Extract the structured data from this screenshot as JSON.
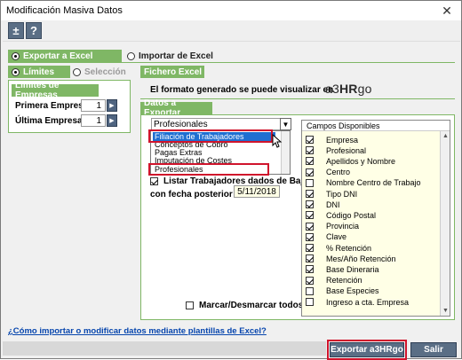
{
  "window": {
    "title": "Modificación Masiva Datos",
    "close_glyph": "✕"
  },
  "toolbar": {
    "plus_label": "±",
    "help_label": "?"
  },
  "modes": {
    "export_label": "Exportar a Excel",
    "import_label": "Importar de Excel"
  },
  "left": {
    "limites_label": "Límites",
    "seleccion_label": "Selección",
    "limites_empresas_title": "Límites de Empresas",
    "primera_label": "Primera Empresa",
    "primera_value": "1",
    "ultima_label": "Última Empresa",
    "ultima_value": "1"
  },
  "fichero": {
    "title": "Fichero Excel",
    "text": "El formato generado se puede visualizar en",
    "logo_a3": "a3",
    "logo_hr": "HR",
    "logo_go": "go"
  },
  "datos": {
    "title": "Datos a Exportar",
    "selected": "Profesionales",
    "options": [
      "Filiación de Trabajadores",
      "Conceptos de Cobro",
      "Pagas Extras",
      "Imputación de Costes",
      "Profesionales"
    ],
    "listar_label": "Listar Trabajadores dados de Baja",
    "fecha_label": "con fecha posterior a",
    "fecha_value": "5/11/2018",
    "marcar_label": "Marcar/Desmarcar todos"
  },
  "campos": {
    "header": "Campos Disponibles",
    "items": [
      {
        "label": "Empresa",
        "checked": true
      },
      {
        "label": "Profesional",
        "checked": true
      },
      {
        "label": "Apellidos y Nombre",
        "checked": true
      },
      {
        "label": "Centro",
        "checked": true
      },
      {
        "label": "Nombre Centro de Trabajo",
        "checked": false
      },
      {
        "label": "Tipo DNI",
        "checked": true
      },
      {
        "label": "DNI",
        "checked": true
      },
      {
        "label": "Código Postal",
        "checked": true
      },
      {
        "label": "Provincia",
        "checked": true
      },
      {
        "label": "Clave",
        "checked": true
      },
      {
        "label": "% Retención",
        "checked": true
      },
      {
        "label": "Mes/Año Retención",
        "checked": true
      },
      {
        "label": "Base Dineraria",
        "checked": true
      },
      {
        "label": "Retención",
        "checked": true
      },
      {
        "label": "Base Especies",
        "checked": false
      },
      {
        "label": "Ingreso a cta. Empresa",
        "checked": false
      }
    ]
  },
  "footer": {
    "link": "¿Cómo importar o modificar datos mediante plantillas de Excel?",
    "export_button": "Exportar a3HRgo",
    "exit_button": "Salir"
  },
  "colors": {
    "accent_green": "#7fb765",
    "button_blue": "#5a6e85",
    "highlight_red": "#d0142c",
    "list_selected": "#1f6fd1",
    "panel_yellow": "#ffffe6"
  }
}
